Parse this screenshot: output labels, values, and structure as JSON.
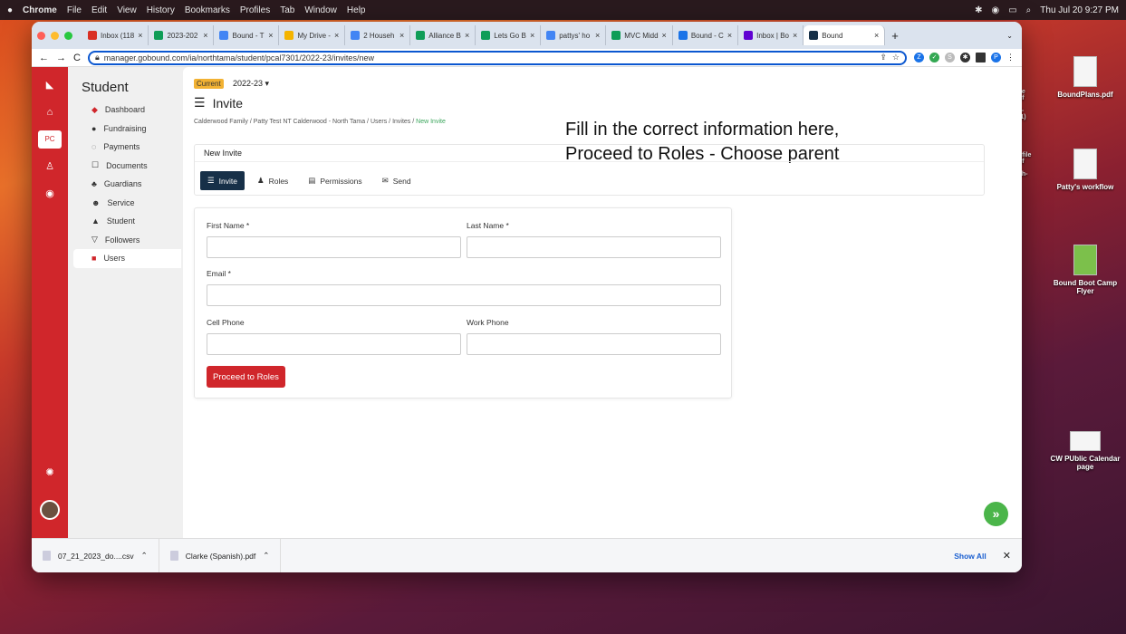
{
  "menubar": {
    "app": "Chrome",
    "items": [
      "File",
      "Edit",
      "View",
      "History",
      "Bookmarks",
      "Profiles",
      "Tab",
      "Window",
      "Help"
    ],
    "clock": "Thu Jul 20  9:27 PM"
  },
  "desktop": {
    "files": [
      {
        "label": "BoundPlans.pdf"
      },
      {
        "label": "Patty's workflow"
      },
      {
        "label": "Bound Boot Camp Flyer"
      },
      {
        "label": "CW PUblic Calendar page"
      }
    ],
    "partials": [
      "ee",
      "df",
      "ll-",
      "(1)",
      "ofile",
      "df",
      "ch-"
    ]
  },
  "browser": {
    "tabs": [
      {
        "label": "Inbox (118",
        "color": "#d93025"
      },
      {
        "label": "2023-202",
        "color": "#0f9d58"
      },
      {
        "label": "Bound - T",
        "color": "#4285f4"
      },
      {
        "label": "My Drive -",
        "color": "#f4b400"
      },
      {
        "label": "2 Househ",
        "color": "#4285f4"
      },
      {
        "label": "Alliance B",
        "color": "#0f9d58"
      },
      {
        "label": "Lets Go B",
        "color": "#0f9d58"
      },
      {
        "label": "pattys' ho",
        "color": "#4285f4"
      },
      {
        "label": "MVC Midd",
        "color": "#0f9d58"
      },
      {
        "label": "Bound - C",
        "color": "#1a73e8"
      },
      {
        "label": "Inbox | Bo",
        "color": "#6001d2"
      },
      {
        "label": "Bound",
        "color": "#173048",
        "active": true
      }
    ],
    "url": "manager.gobound.com/ia/northtama/student/pcal7301/2022-23/invites/new",
    "nav": {
      "back": "←",
      "forward": "→",
      "reload": "C"
    },
    "ext": {
      "z": "Z",
      "s": "S",
      "p": "P"
    }
  },
  "rail": {
    "pc": "PC"
  },
  "sidebar": {
    "title": "Student",
    "items": [
      {
        "label": "Dashboard",
        "icon": "◆"
      },
      {
        "label": "Fundraising",
        "icon": "●"
      },
      {
        "label": "Payments",
        "icon": "◌"
      },
      {
        "label": "Documents",
        "icon": "☐"
      },
      {
        "label": "Guardians",
        "icon": "♣"
      },
      {
        "label": "Service",
        "icon": "☻"
      },
      {
        "label": "Student",
        "icon": "▲"
      },
      {
        "label": "Followers",
        "icon": "▽"
      },
      {
        "label": "Users",
        "icon": "■"
      }
    ]
  },
  "page": {
    "badge": "Current",
    "year": "2022-23 ▾",
    "title": "Invite",
    "breadcrumb": [
      "Calderwood Family",
      "Patty Test NT Calderwood - North Tama",
      "Users",
      "Invites",
      "New Invite"
    ],
    "annotation": {
      "line1": "Fill in the correct information here,",
      "line2": "Proceed to Roles - Choose parent"
    },
    "card_header": "New Invite",
    "subtabs": [
      "Invite",
      "Roles",
      "Permissions",
      "Send"
    ],
    "form": {
      "first_name": "First Name *",
      "last_name": "Last Name *",
      "email": "Email *",
      "cell": "Cell Phone",
      "work": "Work Phone",
      "submit": "Proceed to Roles"
    }
  },
  "downloads": {
    "items": [
      "07_21_2023_do....csv",
      "Clarke (Spanish).pdf"
    ],
    "show_all": "Show All"
  },
  "colors": {
    "brand_red": "#d0262b",
    "nav_dark": "#173048",
    "badge": "#f2b233",
    "fab": "#4bb54a"
  }
}
